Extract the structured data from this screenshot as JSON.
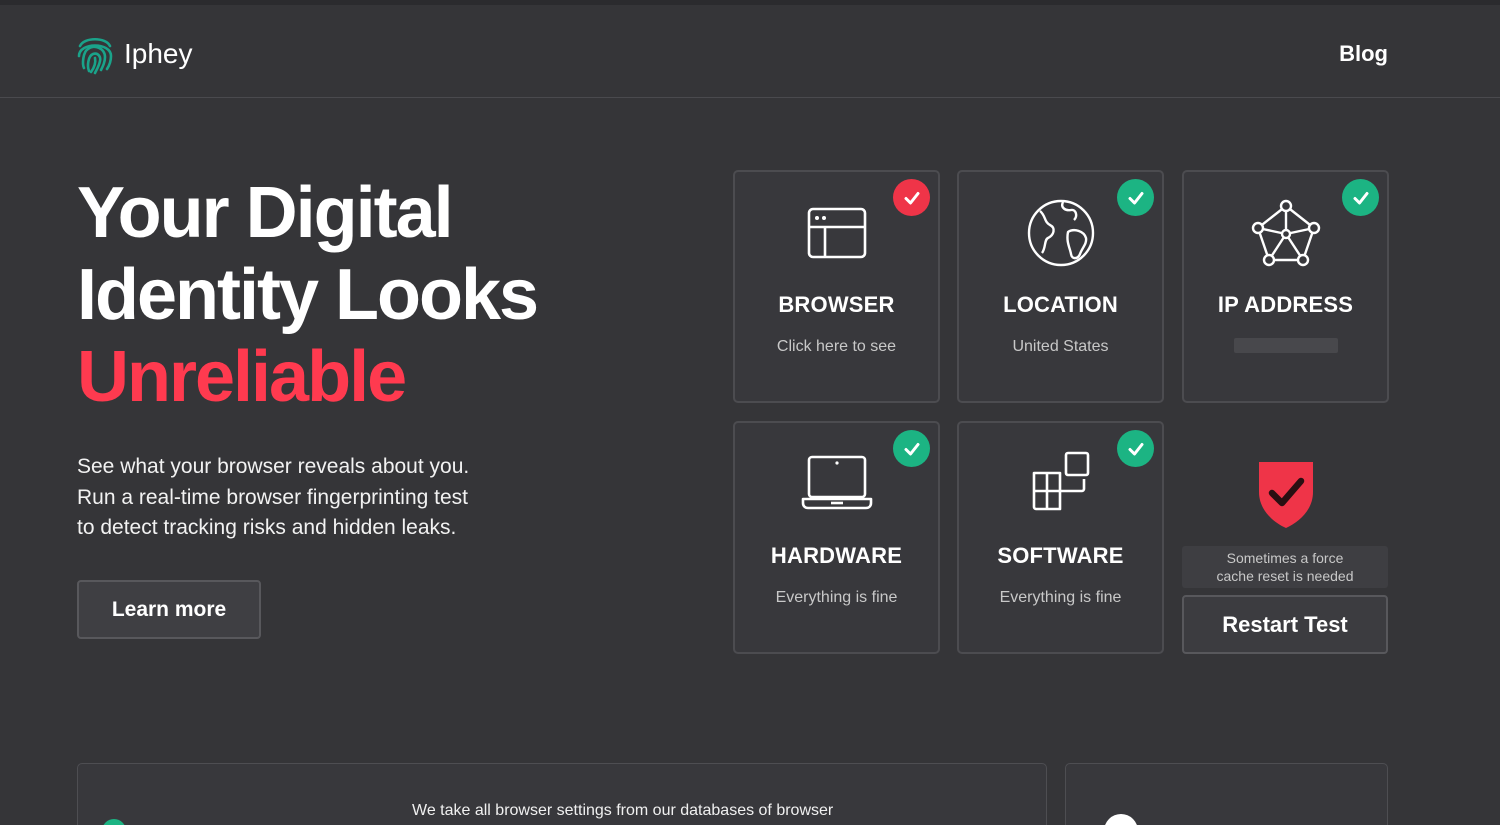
{
  "header": {
    "brand": "Iphey",
    "logo_icon": "fingerprint-icon",
    "nav": {
      "blog": "Blog"
    }
  },
  "hero": {
    "title_lines": [
      "Your Digital",
      "Identity Looks"
    ],
    "title_accent": "Unreliable",
    "description_lines": [
      "See what your browser reveals about you.",
      "Run a real-time browser fingerprinting test",
      "to detect tracking risks and hidden leaks."
    ],
    "learn_more": "Learn more"
  },
  "cards": [
    {
      "icon": "browser-window-icon",
      "title": "BROWSER",
      "subtitle": "Click here to see",
      "status": "bad"
    },
    {
      "icon": "globe-icon",
      "title": "LOCATION",
      "subtitle": "United States",
      "status": "ok"
    },
    {
      "icon": "network-icon",
      "title": "IP ADDRESS",
      "subtitle": "",
      "status": "ok"
    },
    {
      "icon": "laptop-icon",
      "title": "HARDWARE",
      "subtitle": "Everything is fine",
      "status": "ok"
    },
    {
      "icon": "apps-icon",
      "title": "SOFTWARE",
      "subtitle": "Everything is fine",
      "status": "ok"
    }
  ],
  "result": {
    "icon": "shield-check-icon",
    "note_lines": [
      "Sometimes a force",
      "cache reset is needed"
    ],
    "restart": "Restart Test"
  },
  "bottom": {
    "text": "We take all browser settings from our databases of browser"
  },
  "colors": {
    "background": "#353538",
    "accent_red": "#ff3a4f",
    "ok_green": "#1cb483",
    "bad_red": "#ef3448",
    "brand_teal": "#1aa38a"
  }
}
